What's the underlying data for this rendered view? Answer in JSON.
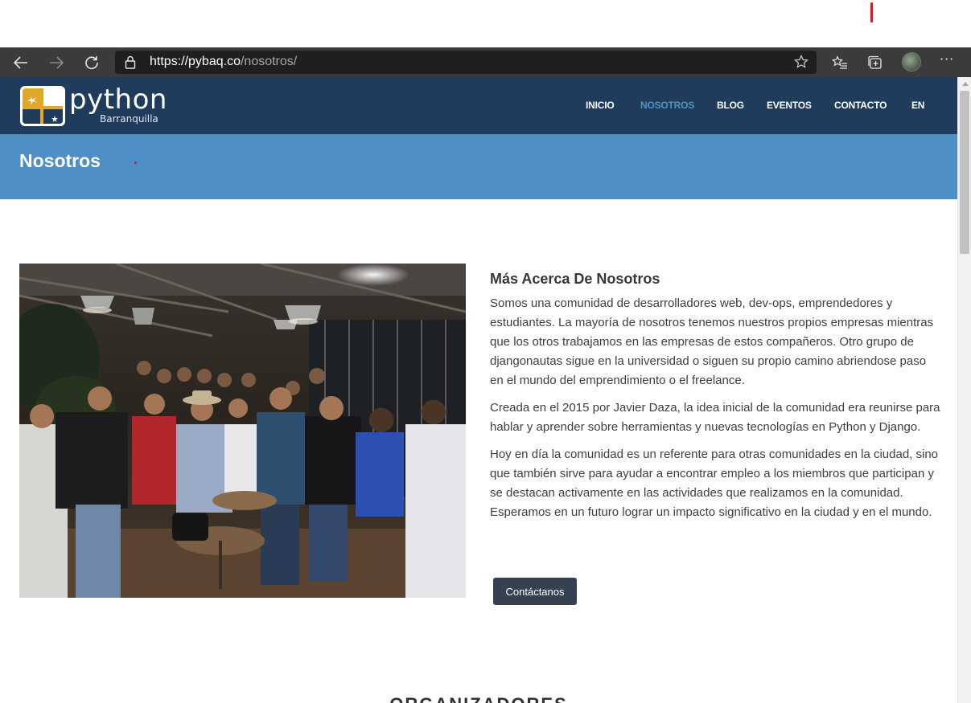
{
  "browser": {
    "url_host": "https://pybaq.co",
    "url_path": "/nosotros/",
    "icons": [
      "back-icon",
      "forward-icon",
      "refresh-icon",
      "lock-icon",
      "favorite-star-icon",
      "favorites-list-icon",
      "collections-icon",
      "profile-avatar",
      "more-icon"
    ],
    "more_label": "···"
  },
  "site": {
    "logo": {
      "word": "python",
      "sub": "Barranquilla"
    },
    "nav": [
      {
        "label": "INICIO",
        "active": false
      },
      {
        "label": "NOSOTROS",
        "active": true
      },
      {
        "label": "BLOG",
        "active": false
      },
      {
        "label": "EVENTOS",
        "active": false
      },
      {
        "label": "CONTACTO",
        "active": false
      },
      {
        "label": "EN",
        "active": false
      }
    ],
    "colors": {
      "header": "#1f3c5c",
      "band": "#4e8fc7",
      "active_nav": "#4f93c8",
      "button": "#36414f"
    }
  },
  "page": {
    "title": "Nosotros",
    "about": {
      "heading": "Más Acerca De Nosotros",
      "paragraphs": [
        "Somos una comunidad de desarrolladores web, dev-ops, emprendedores y estudiantes. La mayoría de nosotros tenemos nuestros propios empresas mientras que los otros trabajamos en las empresas de estos compañeros. Otro grupo de djangonautas sigue en la universidad o siguen su propio camino abriendose paso en el mundo del emprendimiento o el freelance.",
        "Creada en el 2015 por Javier Daza, la idea inicial de la comunidad era reunirse para hablar y aprender sobre herramientas y nuevas tecnologías en Python y Django.",
        "Hoy en día la comunidad es un referente para otras comunidades en la ciudad, sino que también sirve para ayudar a encontrar empleo a los miembros que participan y se destacan activamente en las actividades que realizamos en la comunidad. Esperamos en un futuro lograr un impacto significativo en la ciudad y en el mundo."
      ],
      "button": "Contáctanos"
    },
    "next_section": "ORGANIZADORES"
  }
}
